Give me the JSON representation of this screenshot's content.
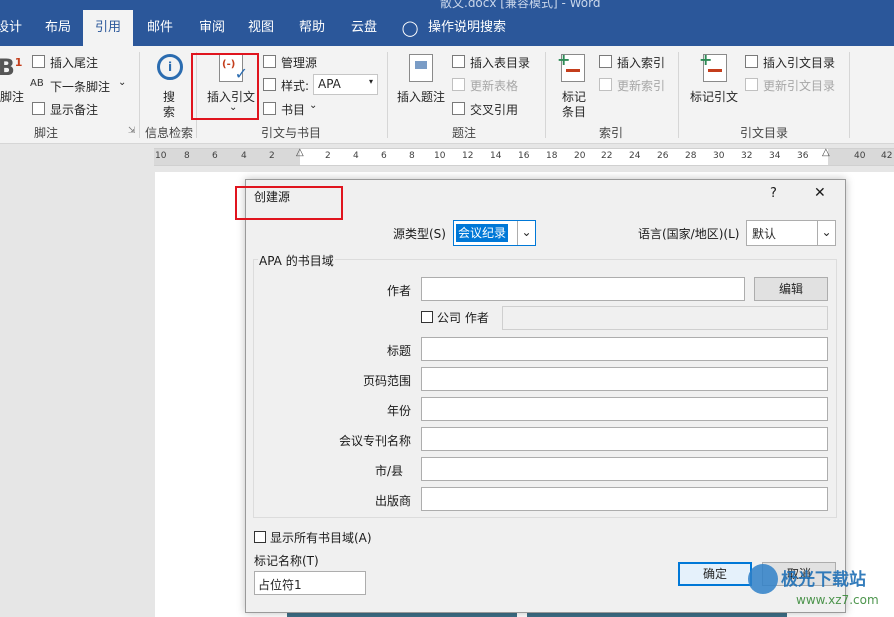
{
  "window": {
    "title": "散文.docx [兼容模式] - Word"
  },
  "tabs": [
    "设计",
    "布局",
    "引用",
    "邮件",
    "审阅",
    "视图",
    "帮助",
    "云盘",
    "操作说明搜索"
  ],
  "ribbon": {
    "footnotes": {
      "big_label": "脚注",
      "insert_endnote": "插入尾注",
      "next_footnote": "下一条脚注",
      "show_notes": "显示备注",
      "group": "脚注"
    },
    "research": {
      "search_line1": "搜",
      "search_line2": "索",
      "group": "信息检索"
    },
    "citations": {
      "insert_citation": "插入引文",
      "manage_sources": "管理源",
      "style_label": "样式:",
      "style_value": "APA",
      "bibliography": "书目",
      "group": "引文与书目"
    },
    "captions": {
      "insert_caption": "插入题注",
      "insert_table_of_figures": "插入表目录",
      "update_table": "更新表格",
      "cross_reference": "交叉引用",
      "group": "题注"
    },
    "index": {
      "mark_entry_line1": "标记",
      "mark_entry_line2": "条目",
      "insert_index": "插入索引",
      "update_index": "更新索引",
      "group": "索引"
    },
    "toa": {
      "mark_citation": "标记引文",
      "insert_toa": "插入引文目录",
      "update_toa": "更新引文目录",
      "group": "引文目录"
    }
  },
  "ruler": [
    "10",
    "8",
    "6",
    "4",
    "2",
    "2",
    "4",
    "6",
    "8",
    "10",
    "12",
    "14",
    "16",
    "18",
    "20",
    "22",
    "24",
    "26",
    "28",
    "30",
    "32",
    "34",
    "36",
    "40",
    "42"
  ],
  "dialog": {
    "title": "创建源",
    "help": "?",
    "close": "✕",
    "source_type_label": "源类型(S)",
    "source_type_value": "会议纪录",
    "language_label": "语言(国家/地区)(L)",
    "language_value": "默认",
    "fields_group": "APA 的书目域",
    "author_label": "作者",
    "edit_button": "编辑",
    "corporate_label": "公司 作者",
    "title_label": "标题",
    "pages_label": "页码范围",
    "year_label": "年份",
    "conference_label": "会议专刊名称",
    "city_label": "市/县",
    "publisher_label": "出版商",
    "show_all_label": "显示所有书目域(A)",
    "tag_label": "标记名称(T)",
    "tag_value": "占位符1",
    "ok_button": "确定",
    "cancel_button": "取消"
  },
  "watermark": {
    "name": "极光下载站",
    "url": "www.xz7.com"
  },
  "colors": {
    "word_blue": "#2b579a",
    "highlight_red": "#e0141e",
    "selection_blue": "#0078d7"
  }
}
